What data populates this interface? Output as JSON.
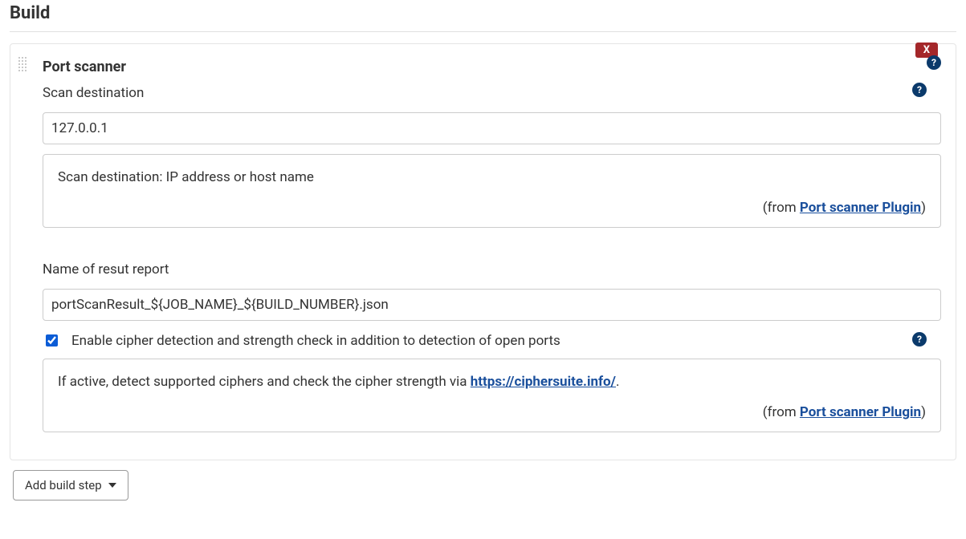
{
  "section": {
    "title": "Build"
  },
  "step": {
    "title": "Port scanner",
    "delete_label": "X"
  },
  "scan_dest": {
    "label": "Scan destination",
    "value": "127.0.0.1",
    "help_text": "Scan destination: IP address or host name",
    "from_prefix": "(from ",
    "plugin_link_text": "Port scanner Plugin",
    "from_suffix": ")"
  },
  "report_name": {
    "label": "Name of resut report",
    "value": "portScanResult_${JOB_NAME}_${BUILD_NUMBER}.json"
  },
  "cipher": {
    "label": "Enable cipher detection and strength check in addition to detection of open ports",
    "help_prefix": "If active, detect supported ciphers and check the cipher strength via ",
    "help_link_text": "https://ciphersuite.info/",
    "help_suffix": ".",
    "from_prefix": "(from ",
    "plugin_link_text": "Port scanner Plugin",
    "from_suffix": ")"
  },
  "add_step": {
    "label": "Add build step"
  }
}
